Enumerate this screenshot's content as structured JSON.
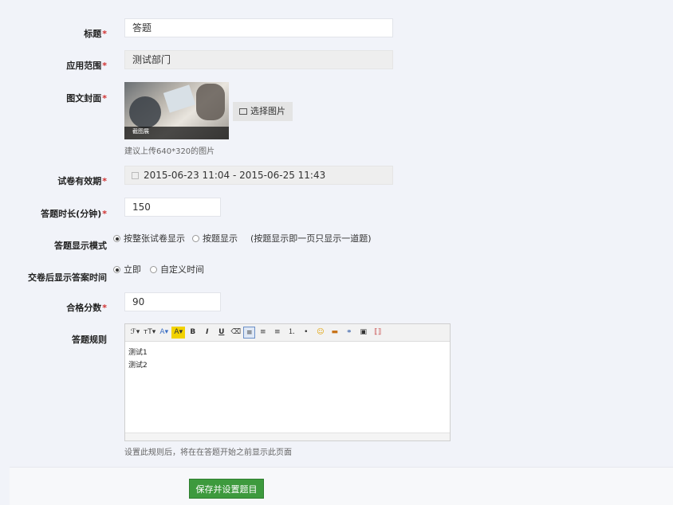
{
  "form": {
    "title": {
      "label": "标题",
      "required_mark": "*",
      "value": "答题"
    },
    "scope": {
      "label": "应用范围",
      "required_mark": "*",
      "value": "测试部门"
    },
    "cover": {
      "label": "图文封面",
      "required_mark": "*",
      "image_caption": "截图展",
      "select_button": "选择图片",
      "hint": "建议上传640*320的图片"
    },
    "validity": {
      "label": "试卷有效期",
      "required_mark": "*",
      "value": "2015-06-23 11:04 - 2015-06-25 11:43"
    },
    "duration": {
      "label": "答题时长(分钟)",
      "required_mark": "*",
      "value": "150"
    },
    "display_mode": {
      "label": "答题显示模式",
      "options": [
        "按整张试卷显示",
        "按题显示"
      ],
      "selected": 0,
      "note": "(按题显示即一页只显示一道题)"
    },
    "answer_time": {
      "label": "交卷后显示答案时间",
      "options": [
        "立即",
        "自定义时间"
      ],
      "selected": 0
    },
    "pass_score": {
      "label": "合格分数",
      "required_mark": "*",
      "value": "90"
    },
    "rules": {
      "label": "答题规则",
      "toolbar": [
        "ℱ▾",
        "ᴛT▾",
        "A▾",
        "A▾",
        "B",
        "I",
        "U",
        "⌫",
        "≡",
        "≡",
        "≡",
        "⒈",
        "•",
        "☺",
        "▬",
        "⚭",
        "▣",
        "⟦⟧"
      ],
      "content_lines": [
        "测试1",
        "测试2"
      ],
      "hint": "设置此规则后，将在在答题开始之前显示此页面"
    }
  },
  "actions": {
    "save": "保存并设置题目"
  }
}
